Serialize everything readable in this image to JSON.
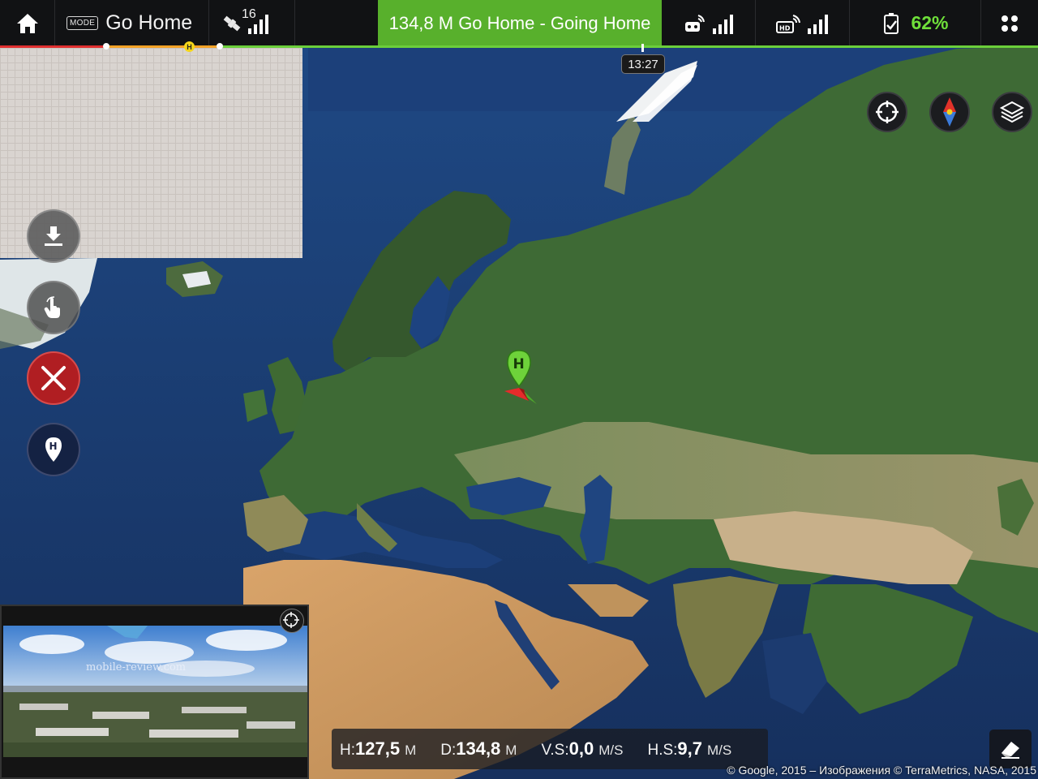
{
  "topbar": {
    "home_icon": "home-icon",
    "mode_badge": "MODE",
    "mode_label": "Go Home",
    "gps_count": "16",
    "status_text": "134,8 M Go Home - Going Home",
    "battery_pct": "62%",
    "colors": {
      "status_bg": "#58b02c",
      "battery": "#6fe03a",
      "bar_bg": "#111214"
    }
  },
  "timeline": {
    "time": "13:27",
    "home_marker_label": "H"
  },
  "map": {
    "home_pin_label": "H",
    "copyright": "© Google, 2015 – Изображения © TerraMetrics, NASA, 2015"
  },
  "camera": {
    "watermark": "mobile-review.com"
  },
  "telemetry": [
    {
      "key": "H:",
      "value": "127,5",
      "unit": "M"
    },
    {
      "key": "D:",
      "value": "134,8",
      "unit": "M"
    },
    {
      "key": "V.S:",
      "value": "0,0",
      "unit": "M/S"
    },
    {
      "key": "H.S:",
      "value": "9,7",
      "unit": "M/S"
    }
  ]
}
